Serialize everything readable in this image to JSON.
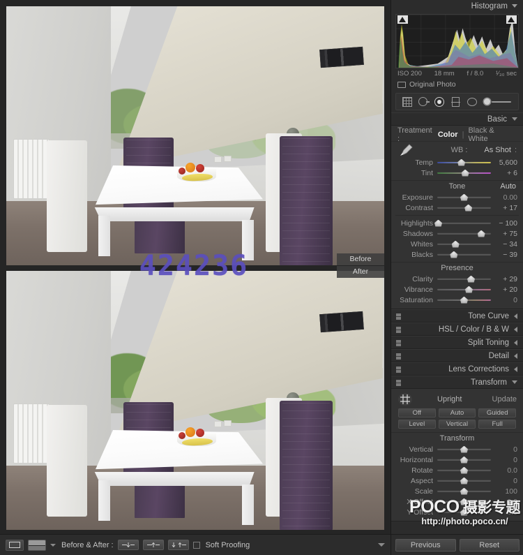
{
  "histogram": {
    "title": "Histogram",
    "iso": "ISO 200",
    "focal": "18 mm",
    "aperture": "f / 8.0",
    "shutter": "¹⁄₃₀ sec",
    "original_photo_label": "Original Photo"
  },
  "tools": {
    "crop": "crop-overlay-icon",
    "spot": "spot-removal-icon",
    "redeye": "red-eye-correction-icon",
    "graduated": "graduated-filter-icon",
    "radial": "radial-filter-icon",
    "brush": "adjustment-brush-icon"
  },
  "basic": {
    "title": "Basic",
    "treatment_label": "Treatment :",
    "treatment_color": "Color",
    "treatment_separator": "|",
    "treatment_bw": "Black & White",
    "wb_label": "WB :",
    "wb_value": "As Shot",
    "wb_caret": ":",
    "sliders_wb": [
      {
        "label": "Temp",
        "value": "5,600",
        "pos": 45
      },
      {
        "label": "Tint",
        "value": "+ 6",
        "pos": 52
      }
    ],
    "tone_title": "Tone",
    "auto_label": "Auto",
    "sliders_tone_top": [
      {
        "label": "Exposure",
        "value": "0.00",
        "pos": 50
      },
      {
        "label": "Contrast",
        "value": "+ 17",
        "pos": 58
      }
    ],
    "sliders_tone_bottom": [
      {
        "label": "Highlights",
        "value": "− 100",
        "pos": 2
      },
      {
        "label": "Shadows",
        "value": "+ 75",
        "pos": 82
      },
      {
        "label": "Whites",
        "value": "− 34",
        "pos": 34
      },
      {
        "label": "Blacks",
        "value": "− 39",
        "pos": 31
      }
    ],
    "presence_title": "Presence",
    "sliders_presence": [
      {
        "label": "Clarity",
        "value": "+ 29",
        "pos": 63
      },
      {
        "label": "Vibrance",
        "value": "+ 20",
        "pos": 59
      },
      {
        "label": "Saturation",
        "value": "0",
        "pos": 50
      }
    ]
  },
  "sections": [
    {
      "name": "tone-curve",
      "title": "Tone Curve",
      "expanded": false
    },
    {
      "name": "hsl-color-bw",
      "title": "HSL / Color / B & W",
      "expanded": false
    },
    {
      "name": "split-toning",
      "title": "Split Toning",
      "expanded": false
    },
    {
      "name": "detail",
      "title": "Detail",
      "expanded": false
    },
    {
      "name": "lens-corrections",
      "title": "Lens Corrections",
      "expanded": false
    }
  ],
  "transform": {
    "title": "Transform",
    "upright_label": "Upright",
    "update_label": "Update",
    "buttons_row1": [
      "Off",
      "Auto",
      "Guided"
    ],
    "buttons_row2": [
      "Level",
      "Vertical",
      "Full"
    ],
    "group_title": "Transform",
    "sliders": [
      {
        "label": "Vertical",
        "value": "0",
        "pos": 50
      },
      {
        "label": "Horizontal",
        "value": "0",
        "pos": 50
      },
      {
        "label": "Rotate",
        "value": "0.0",
        "pos": 50
      },
      {
        "label": "Aspect",
        "value": "0",
        "pos": 50
      },
      {
        "label": "Scale",
        "value": "100",
        "pos": 50
      },
      {
        "label": "X Offset",
        "value": "0.0",
        "pos": 50
      },
      {
        "label": "Y Offset",
        "value": "0.0",
        "pos": 50
      }
    ]
  },
  "footer": {
    "previous": "Previous",
    "reset": "Reset"
  },
  "watermark": {
    "brand": "POCO",
    "brand_cjk": " 摄影专题",
    "url": "http://photo.poco.cn/"
  },
  "image_view": {
    "before_label": "Before",
    "after_label": "After",
    "overlay_number": "424236"
  },
  "toolbar": {
    "before_after_label": "Before & After :",
    "copy_before_to_after": "copy-before-settings-to-after-icon",
    "copy_after_to_before": "copy-after-settings-to-before-icon",
    "swap_before_after": "swap-before-after-settings-icon",
    "soft_proofing_label": "Soft Proofing"
  },
  "colors": {
    "panel_bg": "#2c2c2c",
    "section_bg": "#333333",
    "text": "#b4b4b4",
    "overlay_number": "#5b4fbe"
  }
}
